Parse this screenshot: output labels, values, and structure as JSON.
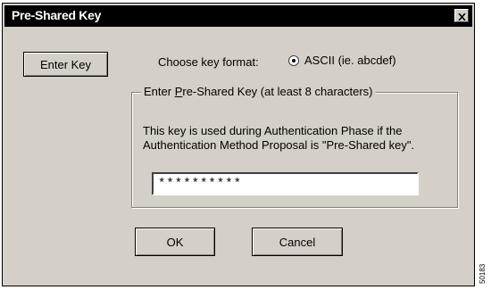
{
  "window": {
    "title": "Pre-Shared Key",
    "close_symbol": "×"
  },
  "enter_key_button": {
    "label": "Enter Key"
  },
  "key_format": {
    "label": "Choose key format:",
    "option_label": "ASCII (ie. abcdef)",
    "selected": true
  },
  "group": {
    "legend_prefix": "Enter ",
    "legend_accel": "P",
    "legend_rest": "re-Shared Key (at least 8 characters)",
    "description": "This key is used during Authentication Phase if the Authentication Method Proposal is \"Pre-Shared key\".",
    "input_value": "**********"
  },
  "buttons": {
    "ok_label": "OK",
    "cancel_label": "Cancel"
  },
  "figure_number": "50183",
  "icons": {
    "close": "close-icon",
    "radio": "radio-selected-icon"
  }
}
